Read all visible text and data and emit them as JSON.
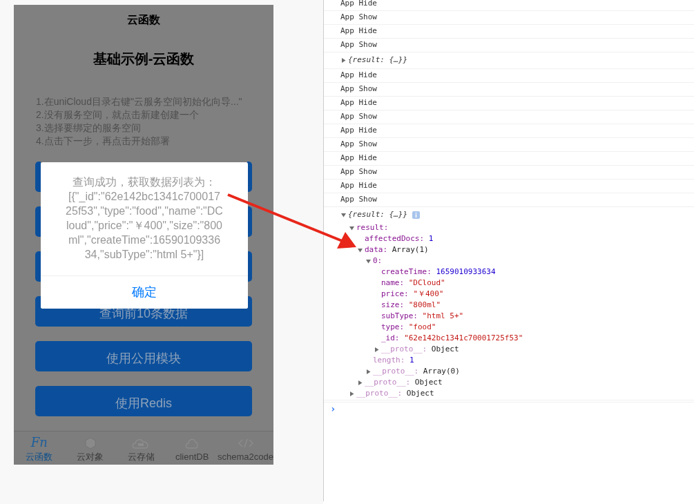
{
  "phone": {
    "nav_title": "云函数",
    "heading": "基础示例-云函数",
    "instructions": [
      "1.在uniCloud目录右键\"云服务空间初始化向导...\"",
      "2.没有服务空间，就点击新建创建一个",
      "3.选择要绑定的服务空间",
      "4.点击下一步，再点击开始部署"
    ],
    "buttons": [
      {
        "kind": "covered"
      },
      {
        "kind": "covered"
      },
      {
        "kind": "covered"
      },
      {
        "kind": "labeled",
        "label": "查询前10条数据"
      },
      {
        "kind": "labeled",
        "label": "使用公用模块"
      },
      {
        "kind": "labeled",
        "label": "使用Redis"
      }
    ],
    "tab_bar": [
      {
        "kind": "fn",
        "glyph": "Fn",
        "label": "云函数",
        "selected": true
      },
      {
        "kind": "object",
        "label": "云对象",
        "selected": false
      },
      {
        "kind": "storage",
        "label": "云存储",
        "selected": false
      },
      {
        "kind": "db",
        "label": "clientDB",
        "selected": false
      },
      {
        "kind": "code",
        "label": "schema2code",
        "selected": false
      }
    ],
    "dialog": {
      "message": "查询成功，获取数据列表为：[{\"_id\":\"62e142bc1341c70001725f53\",\"type\":\"food\",\"name\":\"DCloud\",\"price\":\"￥400\",\"size\":\"800ml\",\"createTime\":1659010933634,\"subType\":\"html 5+\"}]",
      "confirm": "确定"
    }
  },
  "console": {
    "entries": [
      {
        "kind": "log",
        "text": "App Hide"
      },
      {
        "kind": "log",
        "text": "App Show"
      },
      {
        "kind": "log",
        "text": "App Hide"
      },
      {
        "kind": "log",
        "text": "App Show"
      },
      {
        "kind": "object",
        "text": "{result: {…}}",
        "expanded": false
      },
      {
        "kind": "log",
        "text": "App Hide"
      },
      {
        "kind": "log",
        "text": "App Show"
      },
      {
        "kind": "log",
        "text": "App Hide"
      },
      {
        "kind": "log",
        "text": "App Show"
      },
      {
        "kind": "log",
        "text": "App Hide"
      },
      {
        "kind": "log",
        "text": "App Show"
      },
      {
        "kind": "log",
        "text": "App Hide"
      },
      {
        "kind": "log",
        "text": "App Show"
      },
      {
        "kind": "log",
        "text": "App Hide"
      },
      {
        "kind": "log",
        "text": "App Show"
      },
      {
        "kind": "object",
        "text": "{result: {…}}",
        "expanded": true,
        "info": true,
        "children": [
          {
            "key": "result:",
            "expanded": true,
            "dimmed": false,
            "children": [
              {
                "key": "affectedDocs:",
                "value": "1",
                "kind": "number",
                "dimmed": false
              },
              {
                "key": "data:",
                "value": "Array(1)",
                "kind": "plain",
                "expanded": true,
                "dimmed": false,
                "children": [
                  {
                    "key": "0:",
                    "expanded": true,
                    "dimmed": false,
                    "children": [
                      {
                        "key": "createTime:",
                        "value": "1659010933634",
                        "kind": "number",
                        "dimmed": false
                      },
                      {
                        "key": "name:",
                        "value": "\"DCloud\"",
                        "kind": "string",
                        "dimmed": false
                      },
                      {
                        "key": "price:",
                        "value": "\"￥400\"",
                        "kind": "string",
                        "dimmed": false
                      },
                      {
                        "key": "size:",
                        "value": "\"800ml\"",
                        "kind": "string",
                        "dimmed": false
                      },
                      {
                        "key": "subType:",
                        "value": "\"html 5+\"",
                        "kind": "string",
                        "dimmed": false
                      },
                      {
                        "key": "type:",
                        "value": "\"food\"",
                        "kind": "string",
                        "dimmed": false
                      },
                      {
                        "key": "_id:",
                        "value": "\"62e142bc1341c70001725f53\"",
                        "kind": "string",
                        "dimmed": false
                      },
                      {
                        "key": "__proto__:",
                        "value": "Object",
                        "kind": "plain",
                        "expanded": false,
                        "dimmed": true
                      }
                    ]
                  },
                  {
                    "key": "length:",
                    "value": "1",
                    "kind": "number",
                    "dimmed": true
                  },
                  {
                    "key": "__proto__:",
                    "value": "Array(0)",
                    "kind": "plain",
                    "expanded": false,
                    "dimmed": true
                  }
                ]
              },
              {
                "key": "__proto__:",
                "value": "Object",
                "kind": "plain",
                "expanded": false,
                "dimmed": true
              }
            ]
          },
          {
            "key": "__proto__:",
            "value": "Object",
            "kind": "plain",
            "expanded": false,
            "dimmed": true
          }
        ]
      }
    ],
    "prompt": "›"
  }
}
